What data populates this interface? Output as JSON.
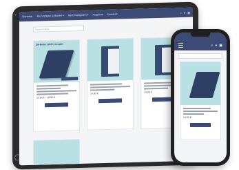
{
  "tablet": {
    "nav_items": [
      "Startseite",
      "Alle Vorlagen & Bündel ▾",
      "Nach Kategorien ▾",
      "Angebote",
      "Kontakt ▾"
    ],
    "search_placeholder": "Suche im Shop …",
    "cards": [
      {
        "label": "QM-Modul 2.2025 | Ausgabe",
        "title_lines": 2,
        "price": "23,90 € – 89,90 €",
        "button": ""
      },
      {
        "label": "",
        "title_lines": 2,
        "price": "14,90 €",
        "button": ""
      },
      {
        "label": "",
        "title_lines": 2,
        "price": "14,90 €",
        "button": ""
      }
    ]
  },
  "phone": {
    "card_price": "14,90 €"
  },
  "icons": [
    "menu-icon",
    "search-icon",
    "user-icon",
    "cart-icon"
  ]
}
